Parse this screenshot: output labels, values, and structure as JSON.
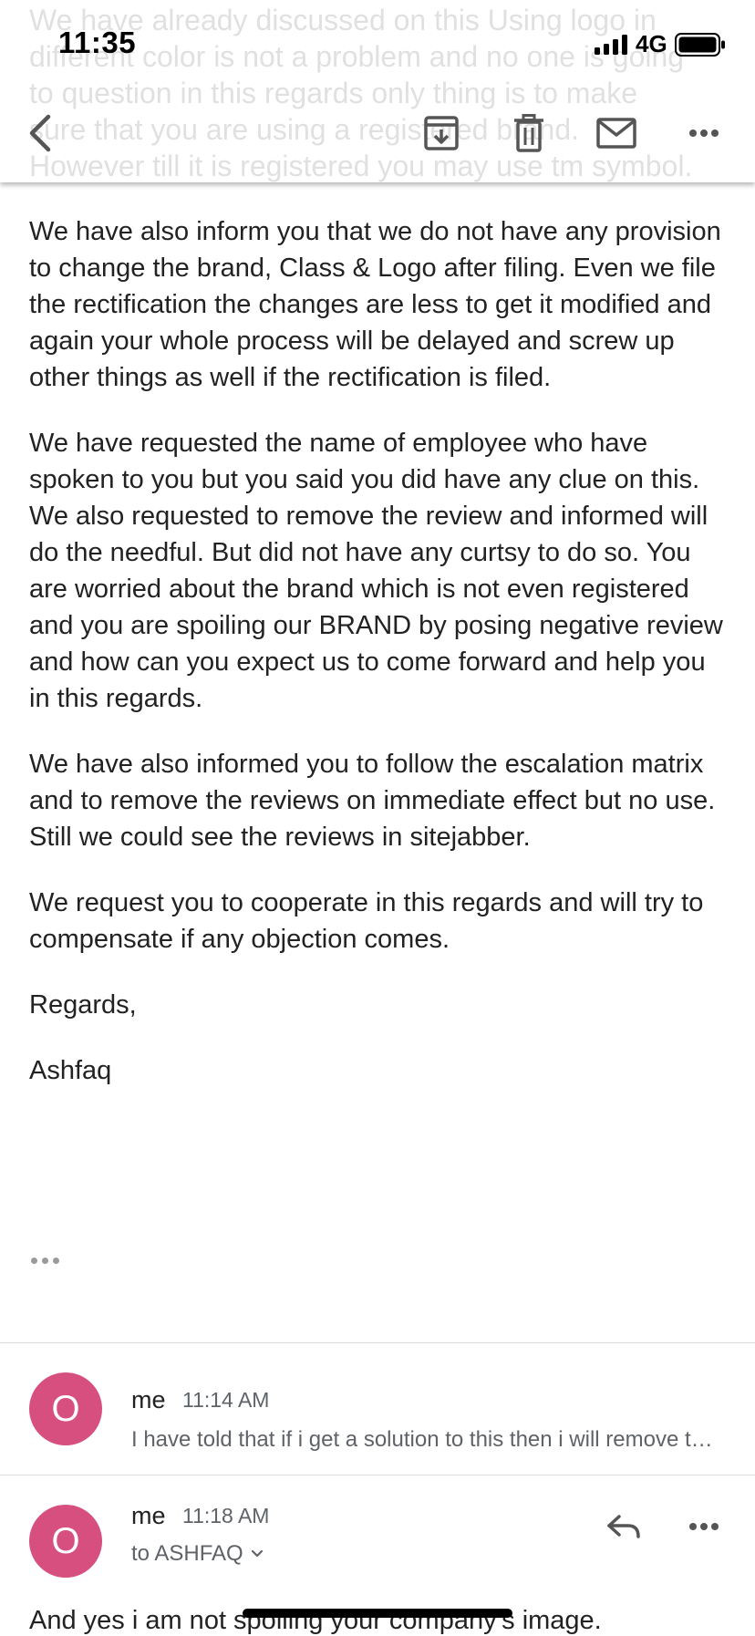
{
  "status_bar": {
    "time": "11:35",
    "network": "4G",
    "signal_bars": 4,
    "battery_icon": "battery-icon"
  },
  "toolbar": {
    "back_icon": "back-icon",
    "archive_icon": "archive-icon",
    "delete_icon": "trash-icon",
    "mark_unread_icon": "mail-icon",
    "more_icon": "more-icon"
  },
  "ghost_text_lines": [
    "We have already discussed on this Using logo in",
    "different color is not a problem and no one is going",
    "to question in this regards only thing is to make",
    "sure that you are using a registered brand.",
    "However till it is registered you may use tm symbol."
  ],
  "email": {
    "paragraphs": [
      "We have also inform you that we do not have any provision to change the brand, Class  & Logo after filing. Even we file the rectification the changes are less to get it modified and again your whole process will be delayed and screw up other things as well if the rectification is filed.",
      "We have requested the name of employee who have spoken to you but you said you did have any clue on this. We also requested to remove the review and informed will do the needful. But did not have any curtsy to do so. You are worried about the brand which is not even registered and you are spoiling our BRAND by posing negative review and how can you expect us to come forward and help you in this regards.",
      "We have also informed you to follow the escalation matrix and to remove the reviews on immediate effect but no use. Still we could see the reviews in sitejabber.",
      "We request you to cooperate in this regards and will try to compensate if any objection comes.",
      "Regards,",
      "Ashfaq"
    ]
  },
  "thread": [
    {
      "avatar_letter": "O",
      "sender": "me",
      "time": "11:14 AM",
      "snippet": "I have told that if i get a solution to this then i will remove the review"
    },
    {
      "avatar_letter": "O",
      "sender": "me",
      "time": "11:18 AM",
      "recipient": "to ASHFAQ",
      "body_start": "And yes i am not spoiling your company's image."
    }
  ],
  "colors": {
    "avatar": "#d64f7f",
    "text": "#222222",
    "muted": "#5f6368"
  }
}
